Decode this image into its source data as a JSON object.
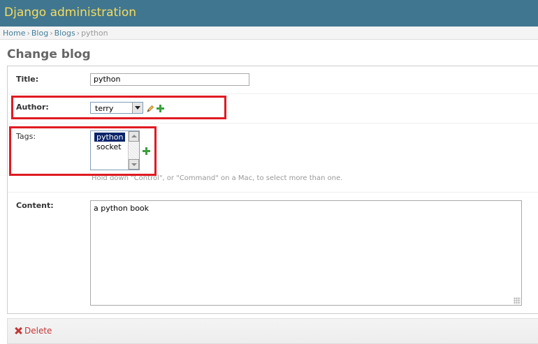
{
  "header": {
    "site_title": "Django administration"
  },
  "breadcrumbs": {
    "items": [
      "Home",
      "Blog",
      "Blogs"
    ],
    "current": "python",
    "separator": "›"
  },
  "page": {
    "title": "Change blog"
  },
  "form": {
    "title": {
      "label": "Title:",
      "value": "python"
    },
    "author": {
      "label": "Author:",
      "selected": "terry"
    },
    "tags": {
      "label": "Tags:",
      "options": [
        {
          "label": "python",
          "selected": true
        },
        {
          "label": "socket",
          "selected": false
        }
      ],
      "help_text": "Hold down \"Control\", or \"Command\" on a Mac, to select more than one."
    },
    "content": {
      "label": "Content:",
      "value": "a python book"
    }
  },
  "submit": {
    "delete_label": "Delete"
  },
  "icons": {
    "edit": "pencil-icon",
    "add": "plus-icon",
    "delete": "delete-x-icon"
  },
  "colors": {
    "header_bg": "#417690",
    "site_title": "#f5dd5d",
    "link": "#447e9b",
    "delete": "#c43536",
    "highlight": "#e01a22",
    "add_icon": "#39a03d",
    "selected_option": "#0a246a"
  }
}
